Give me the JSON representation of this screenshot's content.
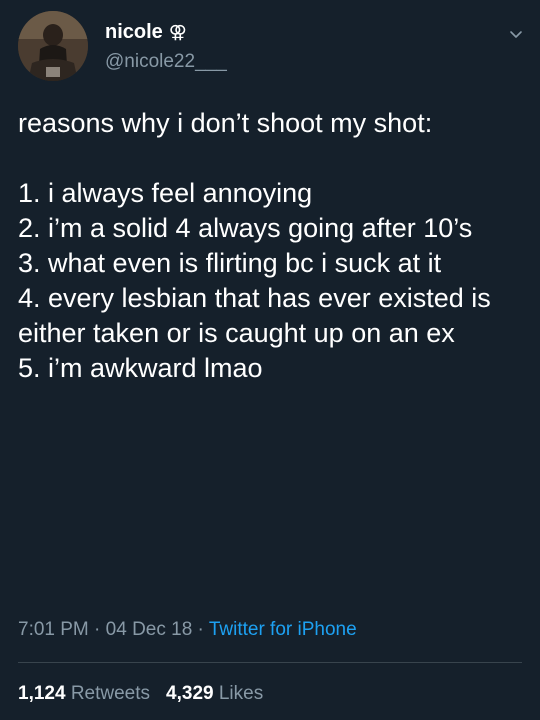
{
  "author": {
    "display_name": "nicole",
    "name_glyph": "⚢",
    "handle": "@nicole22___"
  },
  "tweet": {
    "text": "reasons why i don’t shoot my shot:\n\n1. i always feel annoying\n2. i’m a solid 4 always going after 10’s\n3. what even is flirting bc i suck at it\n4. every lesbian that has ever existed is either taken or is caught up on an ex\n5. i’m awkward lmao"
  },
  "meta": {
    "time": "7:01 PM",
    "sep1": " · ",
    "date": "04 Dec 18",
    "sep2": " · ",
    "source": "Twitter for iPhone"
  },
  "stats": {
    "retweets_count": "1,124",
    "retweets_label": "Retweets",
    "likes_count": "4,329",
    "likes_label": "Likes"
  },
  "icons": {
    "menu": "chevron-down-icon",
    "avatar": "avatar"
  },
  "colors": {
    "background": "#15202b",
    "text": "#ffffff",
    "secondary": "#8899a6",
    "link": "#1da1f2",
    "divider": "#38444d"
  }
}
